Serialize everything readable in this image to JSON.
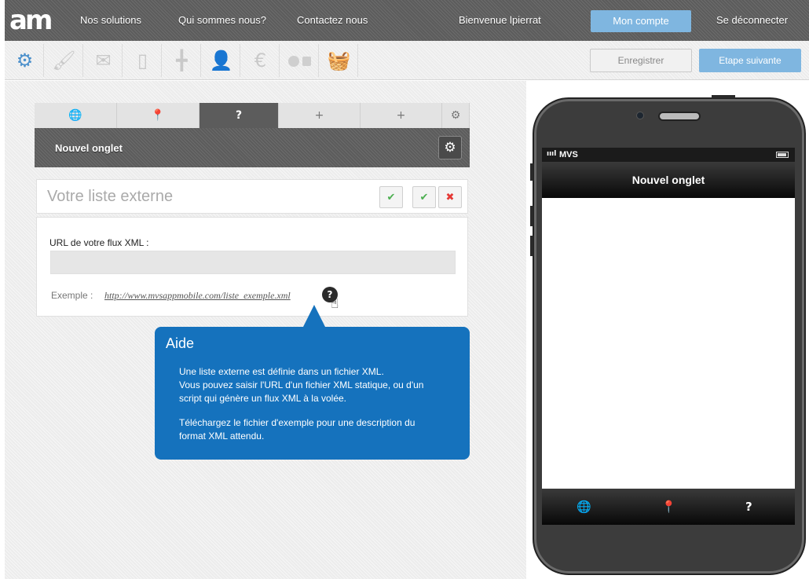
{
  "topnav": {
    "logo": "am",
    "links": [
      "Nos solutions",
      "Qui sommes nous?",
      "Contactez nous"
    ],
    "welcome": "Bienvenue lpierrat",
    "account": "Mon compte",
    "logout": "Se déconnecter",
    "accent": "#7fb6e0"
  },
  "toolbar": {
    "tools": [
      {
        "name": "settings",
        "icon": "gears-icon",
        "glyph": "⚙",
        "active": true
      },
      {
        "name": "design",
        "icon": "brush-icon",
        "glyph": "🖌",
        "active": false
      },
      {
        "name": "mail",
        "icon": "mail-icon",
        "glyph": "✉",
        "active": false
      },
      {
        "name": "mobile",
        "icon": "phone-icon",
        "glyph": "▯",
        "active": false
      },
      {
        "name": "tabs",
        "icon": "grid-icon",
        "glyph": "╋",
        "active": false
      },
      {
        "name": "users",
        "icon": "user-icon",
        "glyph": "👤",
        "active": false
      },
      {
        "name": "money",
        "icon": "euro-icon",
        "glyph": "€",
        "active": false
      },
      {
        "name": "platforms",
        "icon": "apple-android-icon",
        "glyph": "",
        "active": false
      },
      {
        "name": "store",
        "icon": "basket-icon",
        "glyph": "🧺",
        "active": false
      }
    ],
    "save_label": "Enregistrer",
    "next_label": "Etape suivante"
  },
  "tabs": [
    {
      "icon": "globe-icon",
      "glyph": "🌐",
      "active": false
    },
    {
      "icon": "pin-icon",
      "glyph": "📍",
      "active": false
    },
    {
      "icon": "question-icon",
      "glyph": "?",
      "active": true
    },
    {
      "icon": "plus-icon",
      "glyph": "+",
      "active": false
    },
    {
      "icon": "plus-icon",
      "glyph": "+",
      "active": false
    }
  ],
  "tab_settings_glyph": "⚙",
  "tab_header": {
    "title": "Nouvel onglet",
    "gear": "⚙"
  },
  "list_panel": {
    "title": "Votre liste externe",
    "actions": [
      "✔",
      "✔",
      "✖"
    ]
  },
  "form": {
    "url_label": "URL de votre flux XML :",
    "url_value": "",
    "example_label": "Exemple :",
    "example_link": "http://www.mvsappmobile.com/liste_exemple.xml",
    "help_glyph": "?"
  },
  "tooltip": {
    "title": "Aide",
    "lines": [
      "Une liste externe est définie dans un fichier XML.",
      "Vous pouvez saisir l'URL d'un fichier XML statique, ou d'un",
      "script qui génère un flux XML à la volée.",
      "Téléchargez le fichier d'exemple pour une description du",
      "format XML attendu."
    ],
    "color": "#1572bd"
  },
  "phone": {
    "carrier": "MVS",
    "signal": "ıııl",
    "screen_title": "Nouvel onglet",
    "tab_glyphs": [
      "🌐",
      "📍",
      "?"
    ]
  }
}
